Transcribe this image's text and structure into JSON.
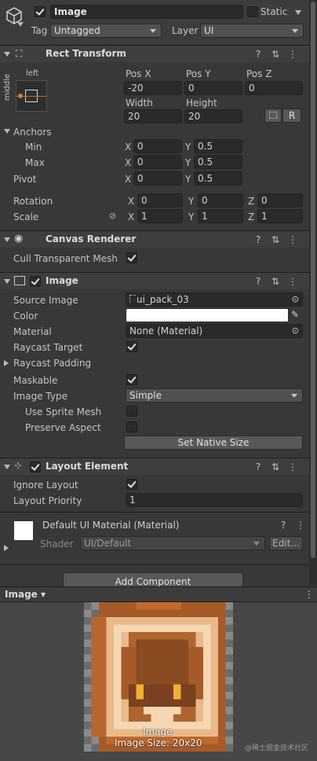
{
  "header": {
    "name": "Image",
    "static_label": "Static",
    "tag_label": "Tag",
    "tag_value": "Untagged",
    "layer_label": "Layer",
    "layer_value": "UI"
  },
  "rect_transform": {
    "title": "Rect Transform",
    "anchor_h": "left",
    "anchor_v": "middle",
    "pos_x_label": "Pos X",
    "pos_y_label": "Pos Y",
    "pos_z_label": "Pos Z",
    "pos_x": "-20",
    "pos_y": "0",
    "pos_z": "0",
    "width_label": "Width",
    "height_label": "Height",
    "width": "20",
    "height": "20",
    "r_button": "R",
    "anchors_label": "Anchors",
    "min_label": "Min",
    "max_label": "Max",
    "pivot_label": "Pivot",
    "min_x": "0",
    "min_y": "0.5",
    "max_x": "0",
    "max_y": "0.5",
    "pivot_x": "0",
    "pivot_y": "0.5",
    "rotation_label": "Rotation",
    "scale_label": "Scale",
    "rot_x": "0",
    "rot_y": "0",
    "rot_z": "0",
    "scale_x": "1",
    "scale_y": "1",
    "scale_z": "1",
    "x": "X",
    "y": "Y",
    "z": "Z"
  },
  "canvas_renderer": {
    "title": "Canvas Renderer",
    "cull_label": "Cull Transparent Mesh",
    "cull_checked": true
  },
  "image": {
    "title": "Image",
    "source_image_label": "Source Image",
    "source_image": "ui_pack_03",
    "color_label": "Color",
    "color_value": "#ffffff",
    "material_label": "Material",
    "material_value": "None (Material)",
    "raycast_target_label": "Raycast Target",
    "raycast_padding_label": "Raycast Padding",
    "maskable_label": "Maskable",
    "image_type_label": "Image Type",
    "image_type": "Simple",
    "use_sprite_mesh_label": "Use Sprite Mesh",
    "preserve_aspect_label": "Preserve Aspect",
    "set_native_size": "Set Native Size"
  },
  "layout_element": {
    "title": "Layout Element",
    "ignore_layout_label": "Ignore Layout",
    "layout_priority_label": "Layout Priority",
    "layout_priority": "1"
  },
  "material_block": {
    "title": "Default UI Material (Material)",
    "shader_label": "Shader",
    "shader_value": "UI/Default",
    "edit_button": "Edit..."
  },
  "add_component": "Add Component",
  "preview": {
    "dropdown": "Image",
    "caption": "Image",
    "size_caption": "Image Size: 20x20"
  },
  "watermark": "@稀土掘金技术社区",
  "colors": {
    "panel": "#383838",
    "header": "#3e3e3e",
    "field": "#2a2a2a",
    "accent_orange": "#c0692c"
  }
}
